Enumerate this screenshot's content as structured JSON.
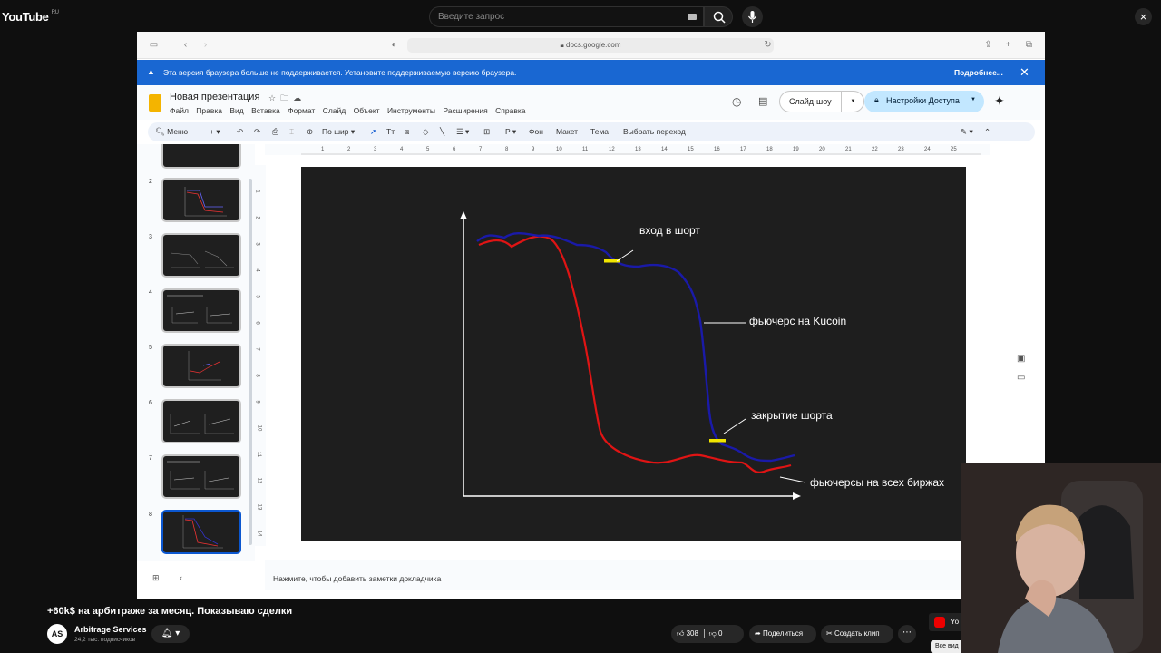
{
  "youtube": {
    "logo": "YouTube",
    "region": "RU",
    "search_placeholder": "Введите запрос",
    "video_title": "+60k$ на арбитраже за месяц. Показываю сделки",
    "channel_initials": "AS",
    "channel_name": "Arbitrage Services",
    "subscribers": "24,2 тыс. подписчиков",
    "likes": "308",
    "dislikes": "0",
    "share_label": "Поделиться",
    "clip_label": "Создать клип",
    "card_label": "Yo",
    "all_videos": "Все вид"
  },
  "browser": {
    "url": "docs.google.com",
    "banner_text": "Эта версия браузера больше не поддерживается. Установите поддерживаемую версию браузера.",
    "banner_link": "Подробнее..."
  },
  "slides_app": {
    "doc_title": "Новая презентация",
    "menu": [
      "Файл",
      "Правка",
      "Вид",
      "Вставка",
      "Формат",
      "Слайд",
      "Объект",
      "Инструменты",
      "Расширения",
      "Справка"
    ],
    "slideshow_label": "Слайд-шоу",
    "access_label": "Настройки Доступа",
    "toolbar": {
      "menu_search": "Меню",
      "zoom": "По шир",
      "background": "Фон",
      "layout": "Макет",
      "theme": "Тема",
      "transition": "Выбрать переход"
    },
    "slide_numbers": [
      "2",
      "3",
      "4",
      "5",
      "6",
      "7",
      "8"
    ],
    "ruler_h": [
      "1",
      "2",
      "3",
      "4",
      "5",
      "6",
      "7",
      "8",
      "9",
      "10",
      "11",
      "12",
      "13",
      "14",
      "15",
      "16",
      "17",
      "18",
      "19",
      "20",
      "21",
      "22",
      "23",
      "24",
      "25"
    ],
    "ruler_v": [
      "1",
      "2",
      "3",
      "4",
      "5",
      "6",
      "7",
      "8",
      "9",
      "10",
      "11",
      "12",
      "13",
      "14"
    ],
    "notes_placeholder": "Нажмите, чтобы добавить заметки докладчика"
  },
  "slide": {
    "label_entry": "вход в шорт",
    "label_kucoin": "фьючерс на Kucoin",
    "label_close": "закрытие шорта",
    "label_all": "фьючерсы на всех биржах",
    "colors": {
      "blue_line": "#1a1aa8",
      "red_line": "#e01414",
      "marker": "#f2e600"
    }
  }
}
